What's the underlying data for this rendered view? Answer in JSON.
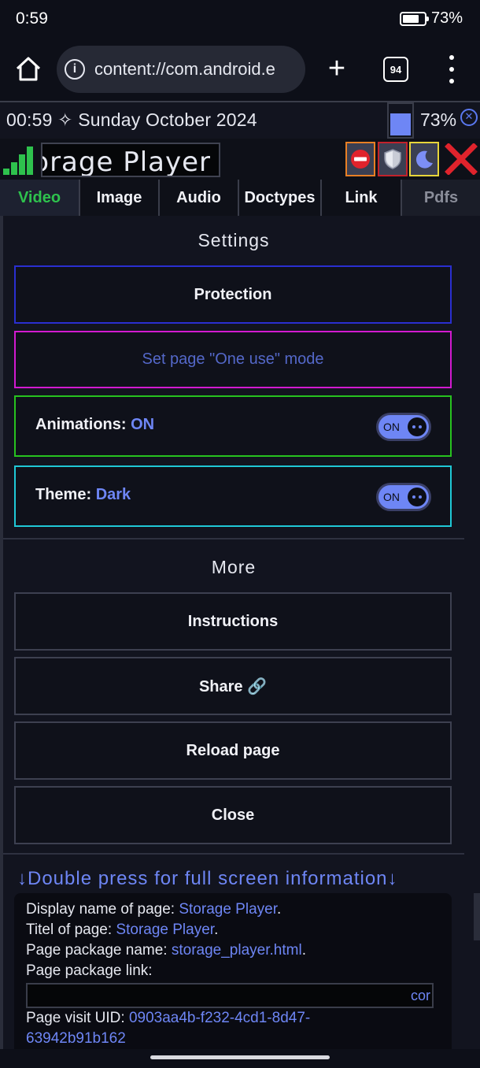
{
  "status_bar": {
    "time": "0:59",
    "battery": "73%"
  },
  "browser": {
    "url": "content://com.android.e",
    "tab_count": "94"
  },
  "date_bar": {
    "datetime": "00:59 ✧ Sunday October 2024",
    "battery_pct": "73%",
    "battery_level": 0.73
  },
  "app": {
    "title": "orage Player"
  },
  "tabs": [
    {
      "label": "Video"
    },
    {
      "label": "Image"
    },
    {
      "label": "Audio"
    },
    {
      "label": "Doctypes"
    },
    {
      "label": "Link"
    },
    {
      "label": "Pdfs"
    }
  ],
  "settings": {
    "title": "Settings",
    "protection": "Protection",
    "one_use": "Set page \"One use\" mode",
    "animations_label": "Animations:",
    "animations_value": "ON",
    "animations_toggle": "ON",
    "theme_label": "Theme:",
    "theme_value": "Dark",
    "theme_toggle": "ON"
  },
  "more": {
    "title": "More",
    "instructions": "Instructions",
    "share": "Share 🔗",
    "reload": "Reload page",
    "close": "Close"
  },
  "info": {
    "hint": "↓Double press for full screen information↓",
    "display_name_label": "Display name of page:",
    "display_name_value": "Storage Player",
    "titel_label": "Titel of page:",
    "titel_value": "Storage Player",
    "package_name_label": "Page package name:",
    "package_name_value": "storage_player.html",
    "package_link_label": "Page package link:",
    "package_link_value": "cor",
    "uid_label": "Page visit UID:",
    "uid_value_1": "0903aa4b-f232-4cd1-8d47-",
    "uid_value_2": "63942b91b162"
  },
  "colors": {
    "accent": "#6e86f5",
    "active_tab": "#2ec24d",
    "close_red": "#e0232c"
  }
}
